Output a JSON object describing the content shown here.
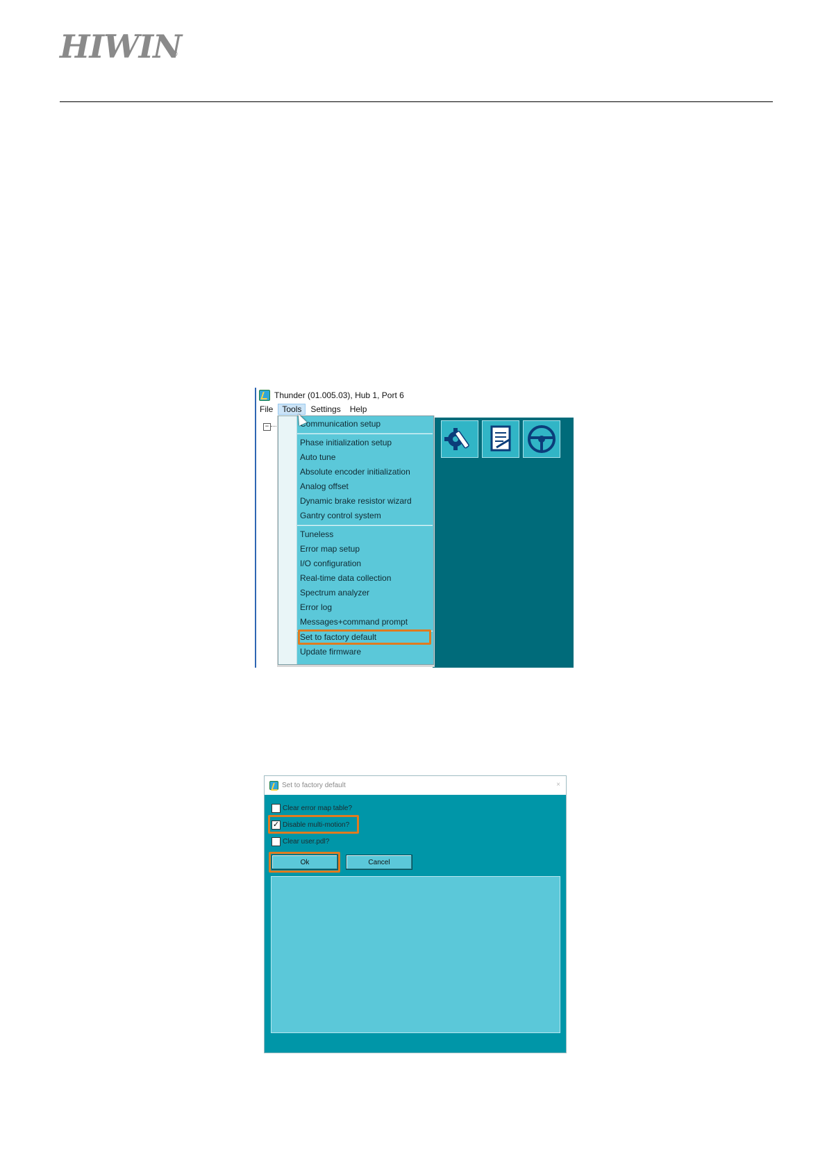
{
  "header": {
    "logo_text": "HIWIN",
    "logo_mark": "®"
  },
  "main_window": {
    "title": "Thunder (01.005.03), Hub 1, Port 6",
    "menu": [
      "File",
      "Tools",
      "Settings",
      "Help"
    ],
    "active_menu": "Tools",
    "tree_toggle": "−",
    "toolbar_icons": [
      "gear-wrench-icon",
      "document-edit-icon",
      "steering-wheel-icon"
    ],
    "tools_menu": {
      "group1": [
        "Communication setup"
      ],
      "group2": [
        "Phase initialization setup",
        "Auto tune",
        "Absolute encoder initialization",
        "Analog offset",
        "Dynamic brake resistor wizard",
        "Gantry control system"
      ],
      "group3": [
        "Tuneless",
        "Error map setup",
        "I/O configuration",
        "Real-time data collection",
        "Spectrum analyzer",
        "Error log",
        "Messages+command prompt"
      ],
      "group4": [
        "Set to factory default",
        "Update firmware"
      ],
      "highlighted": "Set to factory default"
    },
    "colors": {
      "menu_bg": "#5bc8d9",
      "workspace_bg": "#006b7a",
      "highlight": "#e07b1f"
    }
  },
  "factory_dialog": {
    "title": "Set to factory default",
    "options": [
      {
        "label": "Clear error map table?",
        "checked": false
      },
      {
        "label": "Disable multi-motion?",
        "checked": true
      },
      {
        "label": "Clear user.pdl?",
        "checked": false
      }
    ],
    "ok_label": "Ok",
    "cancel_label": "Cancel",
    "close_glyph": "×",
    "colors": {
      "dialog_bg": "#0096a8",
      "highlight": "#e07b1f"
    }
  }
}
